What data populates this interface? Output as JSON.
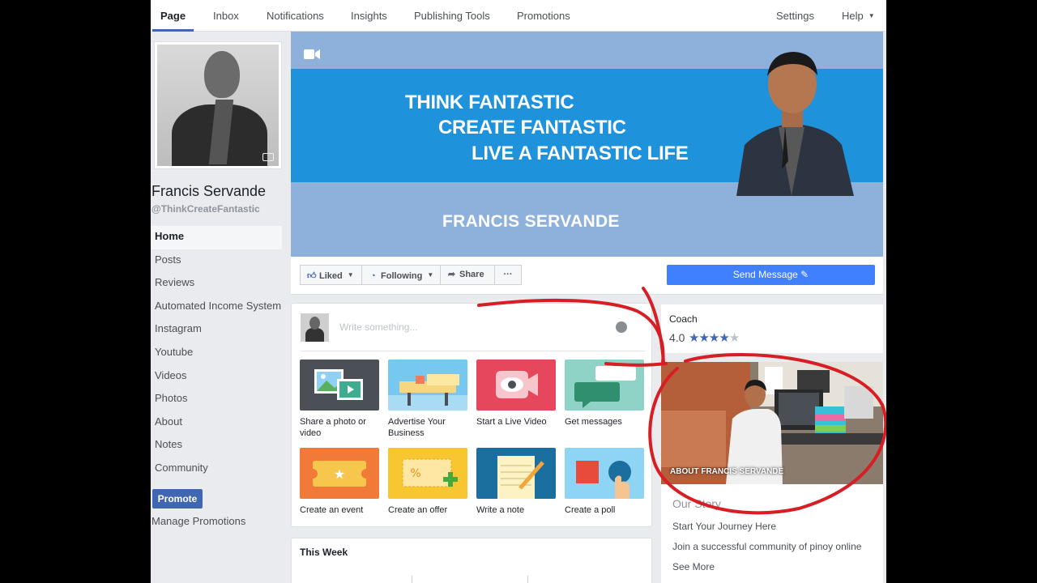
{
  "topnav": {
    "tabs": [
      "Page",
      "Inbox",
      "Notifications",
      "Insights",
      "Publishing Tools",
      "Promotions"
    ],
    "settings": "Settings",
    "help": "Help"
  },
  "profile": {
    "name": "Francis Servande",
    "handle": "@ThinkCreateFantastic"
  },
  "leftnav": {
    "items": [
      "Home",
      "Posts",
      "Reviews",
      "Automated Income System",
      "Instagram",
      "Youtube",
      "Videos",
      "Photos",
      "About",
      "Notes",
      "Community"
    ],
    "promote": "Promote",
    "manage_promotions": "Manage Promotions"
  },
  "cover": {
    "line1": "THINK FANTASTIC",
    "line2": "CREATE FANTASTIC",
    "line3": "LIVE A FANTASTIC LIFE",
    "name": "FRANCIS SERVANDE"
  },
  "actions": {
    "liked": "Liked",
    "following": "Following",
    "share": "Share",
    "more": "···",
    "send_message": "Send Message"
  },
  "composer": {
    "placeholder": "Write something...",
    "tiles": [
      {
        "label": "Share a photo or video"
      },
      {
        "label": "Advertise Your Business"
      },
      {
        "label": "Start a Live Video"
      },
      {
        "label": "Get messages"
      },
      {
        "label": "Create an event"
      },
      {
        "label": "Create an offer"
      },
      {
        "label": "Write a note"
      },
      {
        "label": "Create a poll"
      }
    ]
  },
  "this_week": {
    "title": "This Week"
  },
  "about": {
    "category": "Coach",
    "rating": "4.0",
    "stars_filled": 4,
    "stars_total": 5,
    "photo_label": "ABOUT FRANCIS SERVANDE",
    "story_title": "Our Story",
    "story_lines": [
      "Start Your Journey Here",
      "Join a successful community of pinoy online"
    ],
    "see_more": "See More"
  },
  "colors": {
    "brand": "#4267b2",
    "send_message": "#4080ff",
    "annotation": "#d81e25",
    "cover_band": "#1f92dc",
    "cover_bg": "#8eb1dc"
  }
}
